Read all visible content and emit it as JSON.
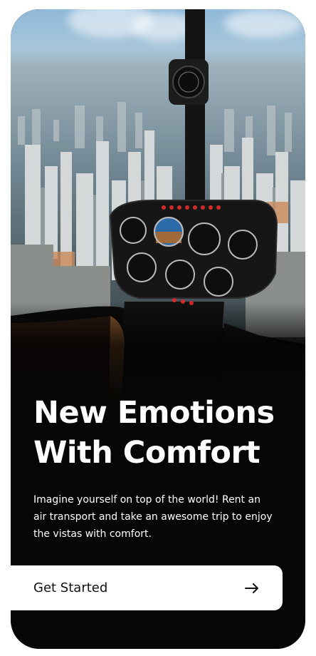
{
  "hero": {
    "image_description": "helicopter-cockpit-over-city"
  },
  "headline": {
    "line1": "New Emotions",
    "line2": "With Comfort"
  },
  "description": "Imagine yourself on top of the world! Rent an air transport and take an awesome trip to enjoy the vistas with comfort.",
  "cta": {
    "label": "Get Started",
    "icon": "arrow-right-icon"
  },
  "colors": {
    "background": "#060606",
    "text": "#ffffff",
    "button_bg": "#ffffff",
    "button_text": "#111111"
  }
}
